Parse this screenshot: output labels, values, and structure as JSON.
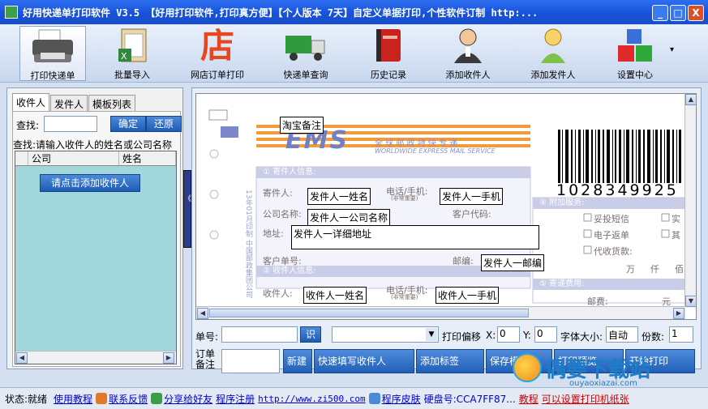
{
  "window": {
    "title": "好用快递单打印软件 V3.5 【好用打印软件,打印真方便】【个人版本  7天】自定义单据打印,个性软件订制  http:...",
    "min_label": "_",
    "max_label": "□",
    "close_label": "X"
  },
  "toolbar": {
    "items": [
      {
        "label": "打印快递单",
        "icon": "printer-icon"
      },
      {
        "label": "批量导入",
        "icon": "excel-import-icon"
      },
      {
        "label": "网店订单打印",
        "icon": "shop-icon",
        "glyph": "店"
      },
      {
        "label": "快递单查询",
        "icon": "truck-icon"
      },
      {
        "label": "历史记录",
        "icon": "book-icon"
      },
      {
        "label": "添加收件人",
        "icon": "recipient-person-icon"
      },
      {
        "label": "添加发件人",
        "icon": "sender-person-icon"
      },
      {
        "label": "设置中心",
        "icon": "cubes-icon"
      }
    ],
    "overflow": "▾"
  },
  "left": {
    "tabs": [
      "收件人",
      "发件人",
      "模板列表"
    ],
    "find_label": "查找:",
    "search_value": "",
    "confirm_label": "确定",
    "restore_label": "还原",
    "hint": "查找:请输入收件人的姓名或公司名称",
    "columns": [
      "公司",
      "姓名"
    ],
    "add_recipient_label": "请点击添加收件人"
  },
  "splitter_glyph": "《《《",
  "canvas": {
    "taobao_note": "淘宝备注",
    "ems_logo": "EMS",
    "ems_cn": "全 球 邮 政 特 快 专 递",
    "ems_en": "WORLDWIDE EXPRESS MAIL SERVICE",
    "barcode_number": "1028349925",
    "sender_section": "① 寄件人信息:",
    "recipient_section": "② 收件人信息:",
    "extra_section": "④ 附加服务:",
    "delivery_section": "⑤ 寄递费用:",
    "lbl_sender": "寄件人:",
    "lbl_phone": "电话/手机:",
    "lbl_phone_sub": "(非常重要)",
    "lbl_company": "公司名称:",
    "lbl_customer_code": "客户代码:",
    "lbl_address": "地址:",
    "lbl_customer_no": "客户单号:",
    "lbl_postcode": "邮编:",
    "lbl_recipient": "收件人:",
    "lbl_postage": "邮费:",
    "lbl_yuan": "元",
    "lbl_wan": "万",
    "lbl_qian": "仟",
    "lbl_bai": "佰",
    "vertical_text": "中国邮政集团公司",
    "vertical_date": "13年01月印制",
    "opt_sms": "妥投短信",
    "opt_ereturn": "电子返单",
    "opt_cod": "代收货款:",
    "opt_actual": "实",
    "opt_other": "其",
    "field_sender_name": "发件人一姓名",
    "field_sender_phone": "发件人一手机",
    "field_sender_company": "发件人一公司名称",
    "field_sender_address": "发件人一详细地址",
    "field_sender_postcode": "发件人一邮编",
    "field_recipient_name": "收件人一姓名",
    "field_recipient_phone": "收件人一手机"
  },
  "bottom": {
    "order_label": "单号:",
    "recog_label": "识",
    "offset_label": "打印偏移",
    "x_label": "X:",
    "x_value": "0",
    "y_label": "Y:",
    "y_value": "0",
    "fontsize_label": "字体大小:",
    "fontsize_value": "自动",
    "copies_label": "份数:",
    "copies_value": "1",
    "order_note_label": "订单\n备注",
    "buttons": [
      "新建",
      "快速填写收件人",
      "添加标签",
      "保存模板",
      "打印预览",
      "开始打印"
    ]
  },
  "statusbar": {
    "status": "状态:就绪",
    "tutorial": "使用教程",
    "feedback": "联系反馈",
    "share": "分享给好友",
    "register": "程序注册",
    "url": "http://www.zi500.com",
    "skin": "程序皮肤",
    "disk": "硬盘号:CCA7FF87...",
    "tutorial2": "教程",
    "set_printer": "可以设置打印机纸张"
  },
  "watermark": {
    "text": "偶要下载站",
    "sub": "ouyaoxiazai.com"
  },
  "colors": {
    "title_blue": "#1550d8",
    "button_blue": "#2060b8",
    "grid_teal": "#a2d8dc",
    "ems_orange": "#f39a3a",
    "ems_blue": "#6f7fc8"
  }
}
